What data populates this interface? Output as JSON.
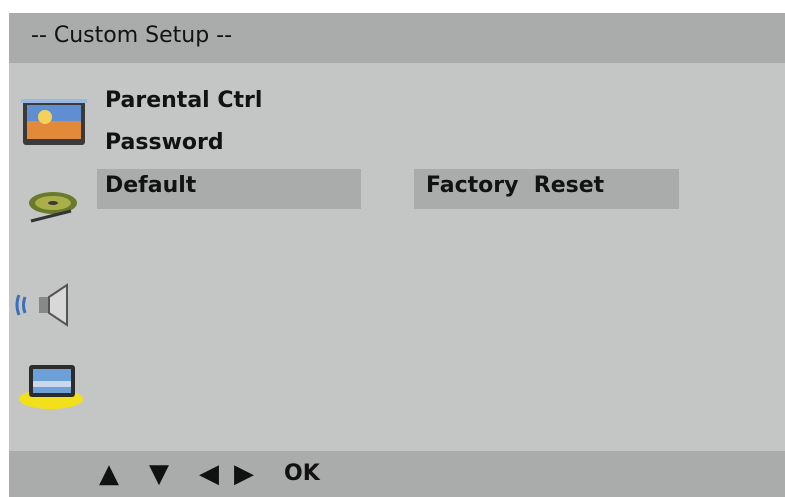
{
  "header": {
    "title": "-- Custom Setup --"
  },
  "menu": {
    "items": [
      {
        "label": "Parental Ctrl"
      },
      {
        "label": "Password"
      },
      {
        "label": "Default",
        "selected": true
      }
    ],
    "selected_value": "Factory  Reset"
  },
  "sidebar": {
    "icons": [
      "tv-picture-icon",
      "disc-icon",
      "speaker-icon",
      "monitor-icon"
    ],
    "active_icon": "monitor-icon",
    "active_color": "#f2e01b"
  },
  "footer": {
    "nav_icons": [
      "up-arrow-icon",
      "down-arrow-icon",
      "left-arrow-icon",
      "right-arrow-icon"
    ],
    "up_glyph": "▲",
    "down_glyph": "▼",
    "left_glyph": "◀",
    "right_glyph": "▶",
    "ok_label": "OK"
  }
}
